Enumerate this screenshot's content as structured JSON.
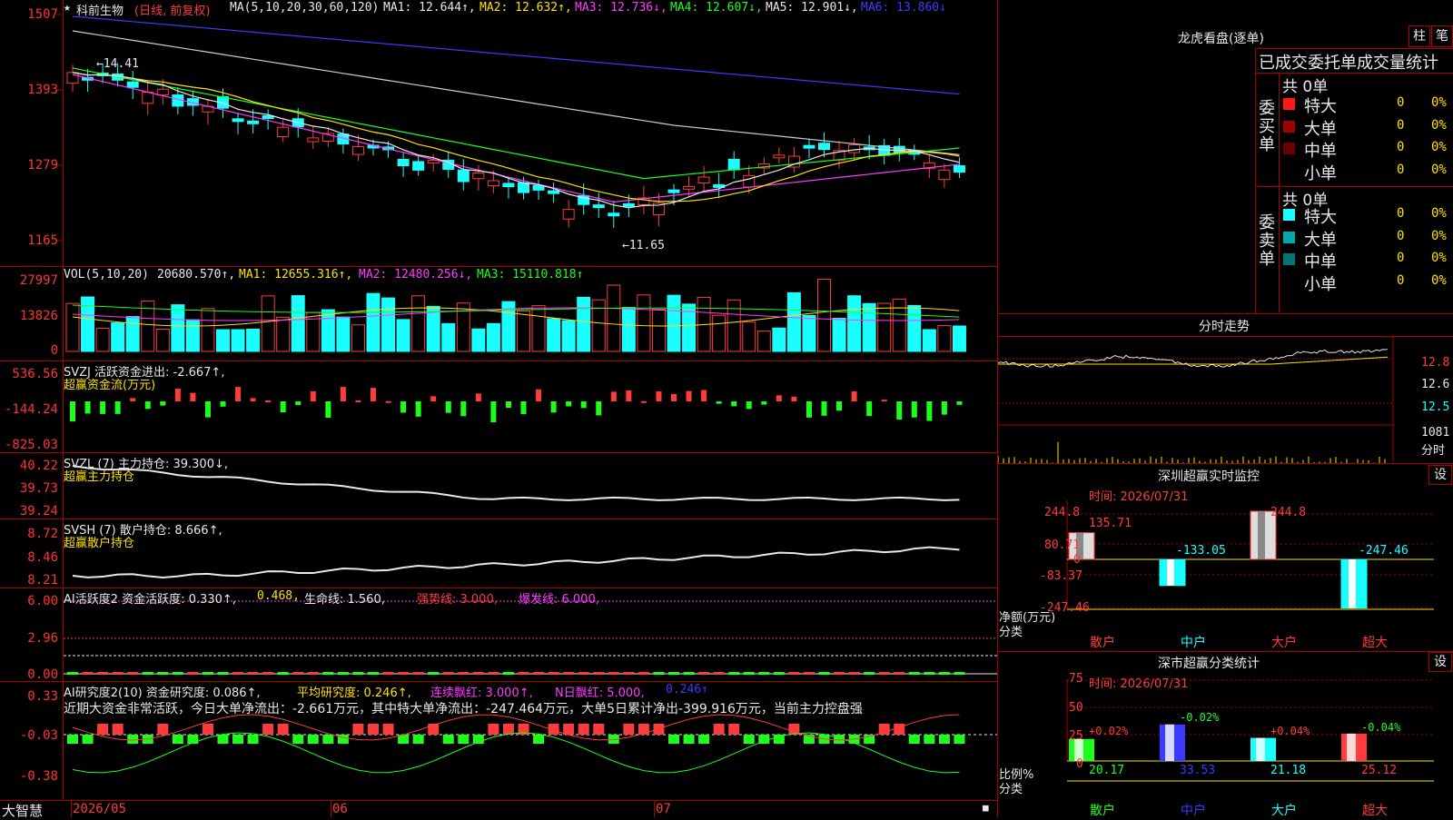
{
  "stock": {
    "name": "科前生物",
    "mode": "(日线, 前复权)"
  },
  "ma_line": {
    "label": "MA(5,10,20,30,60,120)",
    "ma1": "MA1: 12.644↑,",
    "ma2": "MA2: 12.632↑,",
    "ma3": "MA3: 12.736↓,",
    "ma4": "MA4: 12.607↓,",
    "ma5": "MA5: 12.901↓,",
    "ma6": "MA6: 13.860↓"
  },
  "price_axis": [
    "1507",
    "1393",
    "1279",
    "1165"
  ],
  "annotations": {
    "high": "←14.41",
    "low": "←11.65"
  },
  "vol": {
    "label": "VOL(5,10,20)",
    "value": "20680.570↑,",
    "ma1": "MA1: 12655.316↑,",
    "ma2": "MA2: 12480.256↓,",
    "ma3": "MA3: 15110.818↑",
    "axis": [
      "27997",
      "13826",
      "0"
    ]
  },
  "svzj": {
    "label": "SVZJ  活跃资金进出: -2.667↑,",
    "sub": "超赢资金流(万元)",
    "axis": [
      "536.56",
      "-144.24",
      "-825.03"
    ]
  },
  "svzl": {
    "label": "SVZL (7) 主力持仓: 39.300↓,",
    "sub": "超赢主力持仓",
    "axis": [
      "40.22",
      "39.73",
      "39.24"
    ]
  },
  "svsh": {
    "label": "SVSH (7) 散户持仓: 8.666↑,",
    "sub": "超赢散户持仓",
    "axis": [
      "8.72",
      "8.46",
      "8.21"
    ]
  },
  "ai_act": {
    "label": "AI活跃度2 资金活跃度: 0.330↑,",
    "v2": "0.468,",
    "life": "生命线: 1.560,",
    "strong": "强势线: 3.000,",
    "burst": "爆发线: 6.000,",
    "axis": [
      "6.00",
      "2.96",
      "0.00"
    ]
  },
  "ai_res": {
    "label": "AI研究度2(10) 资金研究度: 0.086↑,",
    "avg": "平均研究度: 0.246↑,",
    "red": "连续飘红: 3.000↑,",
    "nred": "N日飘红: 5.000,",
    "last": "0.246↑",
    "note": "近期大资金非常活跃，今日大单净流出：-2.661万元，其中特大单净流出：-247.464万元，大单5日累计净出-399.916万元，当前主力控盘强",
    "axis": [
      "0.33",
      "-0.03",
      "-0.38"
    ]
  },
  "time_axis": {
    "brand": "大智慧",
    "d1": "2026/05",
    "d2": "06",
    "d3": "07"
  },
  "dragon": {
    "title": "龙虎看盘(逐单)",
    "btn1": "柱",
    "btn2": "笔",
    "header": "已成交委托单成交量统计",
    "buy_label": "委买单",
    "sell_label": "委卖单",
    "buy_total": "共 0单",
    "sell_total": "共 0单",
    "buy_rows": [
      {
        "name": "特大",
        "v": "0",
        "p": "0%",
        "c": "#ff1a1a"
      },
      {
        "name": "大单",
        "v": "0",
        "p": "0%",
        "c": "#a00000"
      },
      {
        "name": "中单",
        "v": "0",
        "p": "0%",
        "c": "#6a0000"
      },
      {
        "name": "小单",
        "v": "0",
        "p": "0%",
        "c": "#000"
      }
    ],
    "sell_rows": [
      {
        "name": "特大",
        "v": "0",
        "p": "0%",
        "c": "#19ffff"
      },
      {
        "name": "大单",
        "v": "0",
        "p": "0%",
        "c": "#0aa"
      },
      {
        "name": "中单",
        "v": "0",
        "p": "0%",
        "c": "#077"
      },
      {
        "name": "小单",
        "v": "0",
        "p": "0%",
        "c": "#000"
      }
    ]
  },
  "intraday": {
    "title": "分时走势",
    "axis": [
      "12.8",
      "12.6",
      "12.5"
    ],
    "vol": "1081",
    "vol_unit": "分时"
  },
  "sz_monitor": {
    "title": "深圳超赢实时监控",
    "btn": "设",
    "time": "时间: 2026/07/31",
    "axis": [
      "244.8",
      "80.71",
      "0",
      "-83.37",
      "-247.46"
    ],
    "ylabel": "净额(万元)",
    "xlabel": "分类",
    "bars": [
      {
        "cat": "散户",
        "val": "135.71"
      },
      {
        "cat": "中户",
        "val": "-133.05"
      },
      {
        "cat": "大户",
        "val": "244.8"
      },
      {
        "cat": "超大",
        "val": "-247.46"
      }
    ]
  },
  "sz_stats": {
    "title": "深市超赢分类统计",
    "btn": "设",
    "time": "时间: 2026/07/31",
    "axis": [
      "75",
      "50",
      "25",
      "0"
    ],
    "ylabel": "比例%",
    "xlabel": "分类",
    "bars": [
      {
        "cat": "散户",
        "pct": "20.17",
        "chg": "+0.02%"
      },
      {
        "cat": "中户",
        "pct": "33.53",
        "chg": "-0.02%"
      },
      {
        "cat": "大户",
        "pct": "21.18",
        "chg": "+0.04%"
      },
      {
        "cat": "超大",
        "pct": "25.12",
        "chg": "-0.04%"
      }
    ]
  }
}
